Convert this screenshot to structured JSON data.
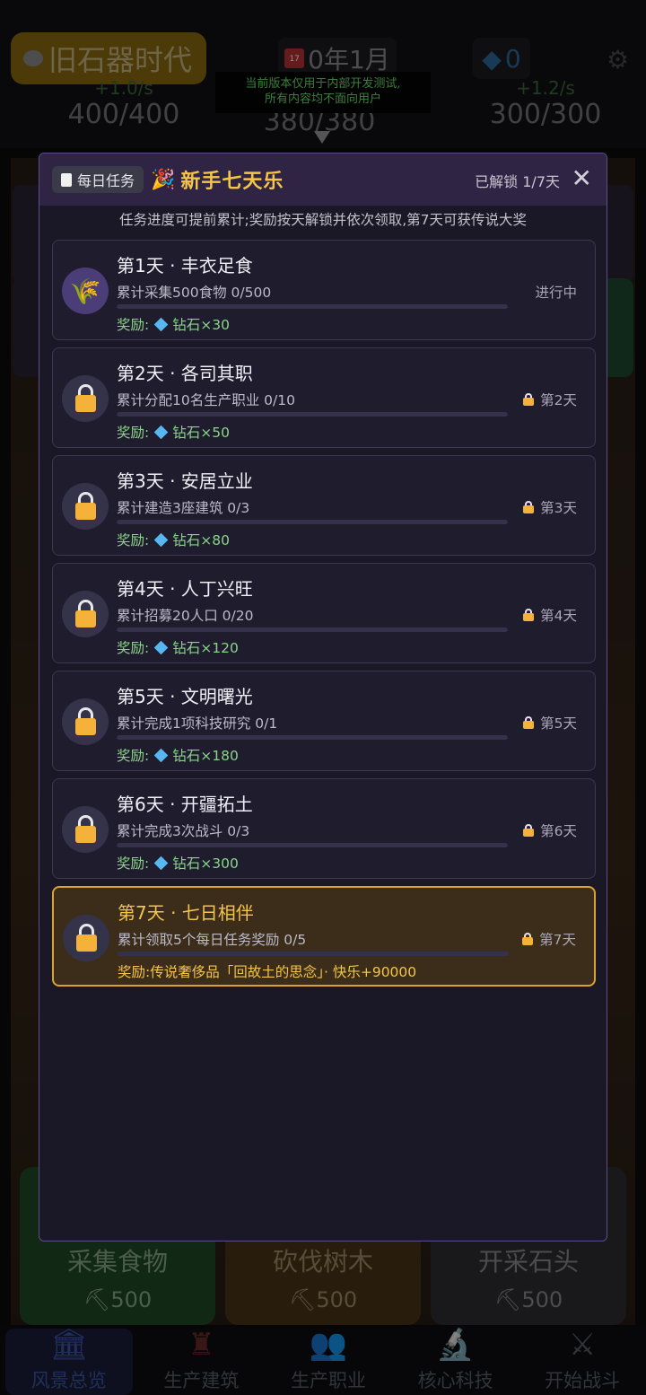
{
  "background": {
    "era": "旧石器时代",
    "date": "0年1月",
    "calendar_day": "17",
    "diamonds": "0",
    "dev_notice_line1": "当前版本仅用于内部开发测试,",
    "dev_notice_line2": "所有内容均不面向用户",
    "resources": [
      {
        "icon": "wheat-icon",
        "rate": "+1.0/s",
        "amount": "400/400"
      },
      {
        "icon": "wood-icon",
        "rate": "",
        "amount": "380/380"
      },
      {
        "icon": "stone-icon",
        "rate": "+1.2/s",
        "amount": "300/300"
      }
    ],
    "actions": [
      {
        "label": "采集食物",
        "cost": "500"
      },
      {
        "label": "砍伐树木",
        "cost": "500"
      },
      {
        "label": "开采石头",
        "cost": "500"
      }
    ],
    "nav": [
      {
        "label": "风景总览",
        "icon": "bank-icon"
      },
      {
        "label": "生产建筑",
        "icon": "tower-icon"
      },
      {
        "label": "生产职业",
        "icon": "people-icon"
      },
      {
        "label": "核心科技",
        "icon": "microscope-icon"
      },
      {
        "label": "开始战斗",
        "icon": "swords-icon"
      }
    ]
  },
  "modal": {
    "tag": "每日任务",
    "title": "新手七天乐",
    "unlock_status": "已解锁 1/7天",
    "subtitle": "任务进度可提前累计;奖励按天解锁并依次领取,第7天可获传说大奖",
    "tasks": [
      {
        "title": "第1天 · 丰衣足食",
        "desc": "累计采集500食物  0/500",
        "reward_label": "奖励:",
        "reward": "钻石×30",
        "status": "进行中",
        "progress": 0,
        "locked": false
      },
      {
        "title": "第2天 · 各司其职",
        "desc": "累计分配10名生产职业  0/10",
        "reward_label": "奖励:",
        "reward": "钻石×50",
        "status": "第2天",
        "progress": 0,
        "locked": true
      },
      {
        "title": "第3天 · 安居立业",
        "desc": "累计建造3座建筑  0/3",
        "reward_label": "奖励:",
        "reward": "钻石×80",
        "status": "第3天",
        "progress": 0,
        "locked": true
      },
      {
        "title": "第4天 · 人丁兴旺",
        "desc": "累计招募20人口  0/20",
        "reward_label": "奖励:",
        "reward": "钻石×120",
        "status": "第4天",
        "progress": 0,
        "locked": true
      },
      {
        "title": "第5天 · 文明曙光",
        "desc": "累计完成1项科技研究  0/1",
        "reward_label": "奖励:",
        "reward": "钻石×180",
        "status": "第5天",
        "progress": 0,
        "locked": true
      },
      {
        "title": "第6天 · 开疆拓土",
        "desc": "累计完成3次战斗  0/3",
        "reward_label": "奖励:",
        "reward": "钻石×300",
        "status": "第6天",
        "progress": 0,
        "locked": true
      },
      {
        "title": "第7天 · 七日相伴",
        "desc": "累计领取5个每日任务奖励  0/5",
        "reward_label": "奖励:",
        "reward": "传说奢侈品「回故土的思念」· 快乐+90000",
        "status": "第7天",
        "progress": 0,
        "locked": true
      }
    ]
  },
  "colors": {
    "accent_gold": "#f5c54a",
    "reward_green": "#8bd38a",
    "lock_orange": "#f4b23a",
    "modal_border": "#5e4e86"
  }
}
